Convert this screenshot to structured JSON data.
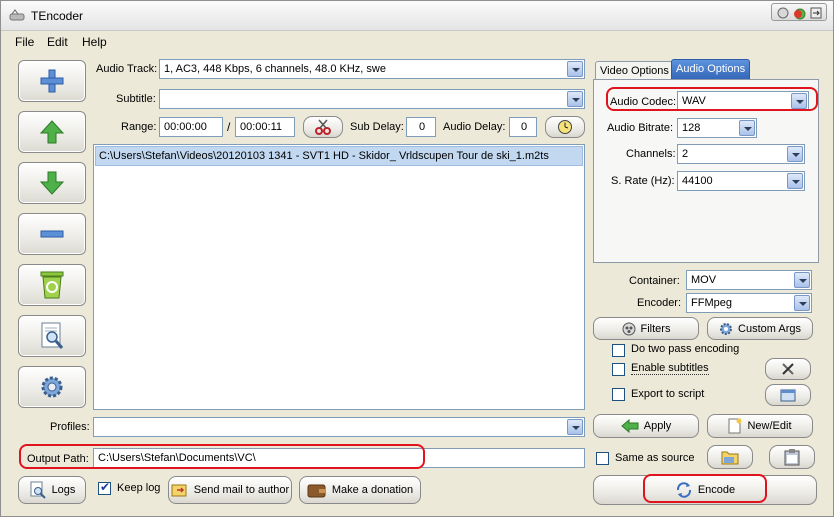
{
  "window": {
    "title": "TEncoder"
  },
  "menu": [
    "File",
    "Edit",
    "Help"
  ],
  "left_tools": [
    "plus-icon",
    "arrow-up-icon",
    "arrow-down-icon",
    "minus-icon",
    "recycle-bin-icon",
    "preview-icon",
    "gear-icon"
  ],
  "source": {
    "audio_track_label": "Audio Track:",
    "audio_track_value": "1, AC3, 448 Kbps, 6 channels, 48.0 KHz, swe",
    "subtitle_label": "Subtitle:",
    "subtitle_value": "",
    "range_label": "Range:",
    "range_start": "00:00:00",
    "range_sep": "/",
    "range_end": "00:00:11",
    "sub_delay_label": "Sub Delay:",
    "sub_delay_value": "0",
    "audio_delay_label": "Audio Delay:",
    "audio_delay_value": "0"
  },
  "files": [
    "C:\\Users\\Stefan\\Videos\\20120103 1341 - SVT1 HD - Skidor_ Vrldscupen Tour de ski_1.m2ts"
  ],
  "profiles": {
    "label": "Profiles:",
    "value": ""
  },
  "output": {
    "label": "Output Path:",
    "value": "C:\\Users\\Stefan\\Documents\\VC\\"
  },
  "bottom": {
    "logs_label": "Logs",
    "keep_log_label": "Keep log",
    "keep_log_checked": true,
    "send_mail_label": "Send mail to author",
    "donation_label": "Make a donation"
  },
  "tabs": {
    "video": "Video Options",
    "audio": "Audio Options"
  },
  "audio_options": {
    "codec_label": "Audio Codec:",
    "codec_value": "WAV",
    "bitrate_label": "Audio Bitrate:",
    "bitrate_value": "128",
    "channels_label": "Channels:",
    "channels_value": "2",
    "rate_label": "S. Rate (Hz):",
    "rate_value": "44100"
  },
  "container": {
    "label": "Container:",
    "value": "MOV"
  },
  "encoder": {
    "label": "Encoder:",
    "value": "FFMpeg"
  },
  "right_buttons": {
    "filters": "Filters",
    "custom_args": "Custom Args",
    "two_pass": "Do two pass encoding",
    "enable_subtitles": "Enable subtitles",
    "export_script": "Export to script",
    "apply": "Apply",
    "new_edit": "New/Edit",
    "same_as_source": "Same as source",
    "encode": "Encode"
  },
  "colors": {
    "highlight_ring": "#e0141e",
    "selection": "#c2d8f1",
    "active_tab": "#3d74c4"
  }
}
